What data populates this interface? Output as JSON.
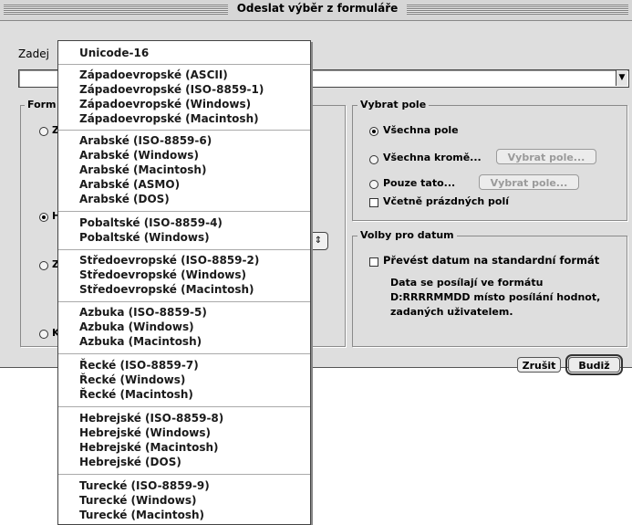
{
  "window": {
    "title": "Odeslat výběr z formuláře"
  },
  "main": {
    "prompt_label": "Zadej",
    "format_group_label": "Form",
    "left_radios": [
      "Z",
      "H",
      "Z",
      "K"
    ],
    "left_radio_selected": 1
  },
  "field_group": {
    "title": "Vybrat pole",
    "all": "Všechna pole",
    "all_except": "Všechna kromě...",
    "only": "Pouze tato...",
    "select_fields_button": "Vybrat pole...",
    "include_empty": "Včetně prázdných polí"
  },
  "date_group": {
    "title": "Volby pro datum",
    "convert": "Převést datum na standardní formát",
    "description": [
      "Data se posílají ve formátu",
      "D:RRRRMMDD místo posílání hodnot,",
      "zadaných uživatelem."
    ]
  },
  "buttons": {
    "cancel": "Zrušit",
    "ok": "Budiž"
  },
  "encoding_menu": {
    "groups": [
      [
        "Unicode-16"
      ],
      [
        "Západoevropské (ASCII)",
        "Západoevropské (ISO-8859-1)",
        "Západoevropské (Windows)",
        "Západoevropské (Macintosh)"
      ],
      [
        "Arabské (ISO-8859-6)",
        "Arabské (Windows)",
        "Arabské (Macintosh)",
        "Arabské (ASMO)",
        "Arabské (DOS)"
      ],
      [
        "Pobaltské (ISO-8859-4)",
        "Pobaltské (Windows)"
      ],
      [
        "Středoevropské (ISO-8859-2)",
        "Středoevropské (Windows)",
        "Středoevropské (Macintosh)"
      ],
      [
        "Azbuka (ISO-8859-5)",
        "Azbuka (Windows)",
        "Azbuka (Macintosh)"
      ],
      [
        "Řecké (ISO-8859-7)",
        "Řecké (Windows)",
        "Řecké (Macintosh)"
      ],
      [
        "Hebrejské (ISO-8859-8)",
        "Hebrejské (Windows)",
        "Hebrejské (Macintosh)",
        "Hebrejské (DOS)"
      ],
      [
        "Turecké (ISO-8859-9)",
        "Turecké (Windows)",
        "Turecké (Macintosh)"
      ]
    ]
  }
}
